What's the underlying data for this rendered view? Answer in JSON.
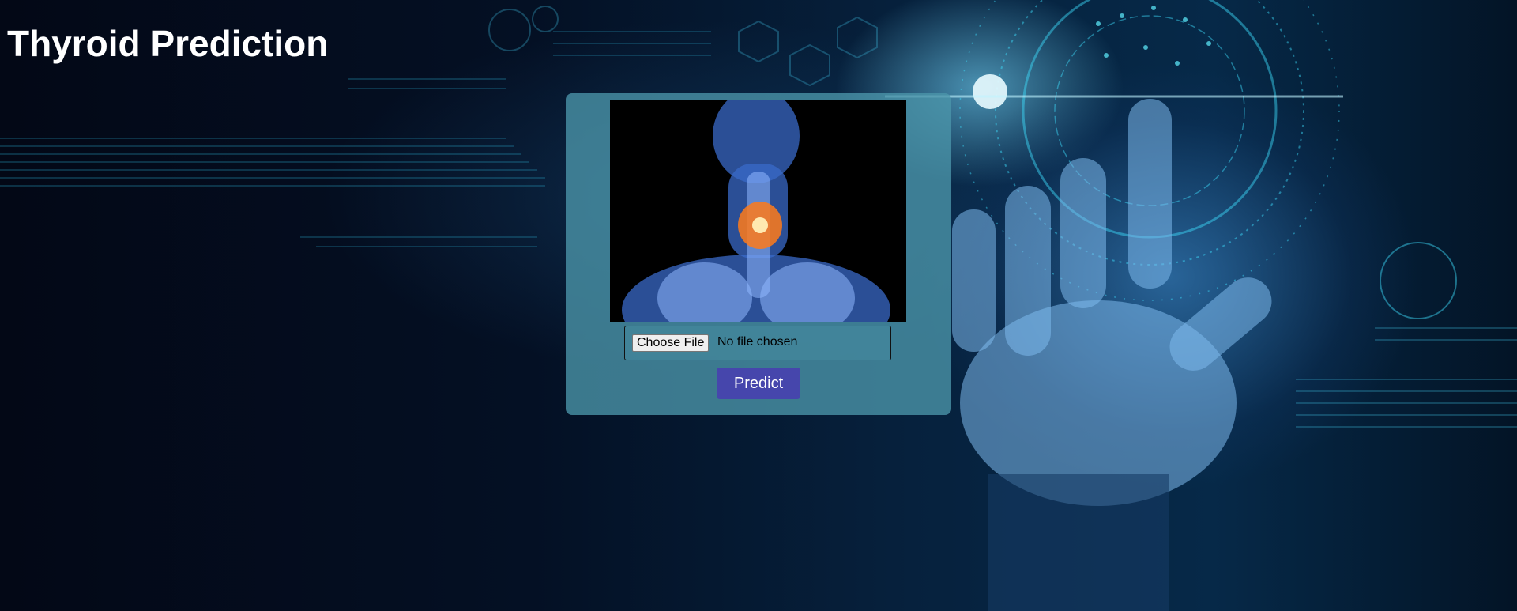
{
  "page": {
    "title": "Thyroid Prediction"
  },
  "upload": {
    "choose_label": "Choose File",
    "status_text": "No file chosen"
  },
  "actions": {
    "predict_label": "Predict"
  },
  "colors": {
    "card": "#4b96aa",
    "predict_button": "#4646ac",
    "background": "#02050f",
    "accent_glow": "#7fe0ff"
  }
}
